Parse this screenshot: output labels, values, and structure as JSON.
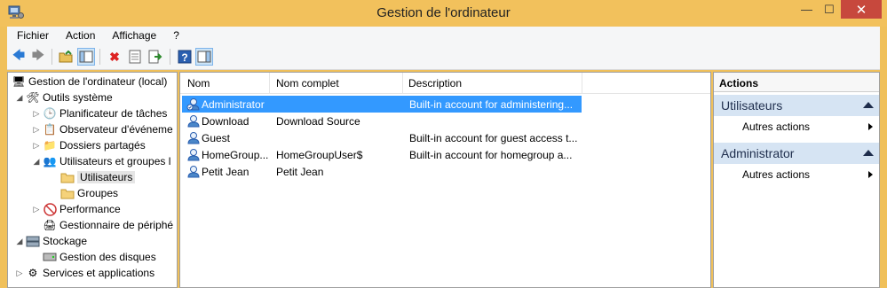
{
  "window": {
    "title": "Gestion de l'ordinateur",
    "min": "—",
    "max": "☐",
    "close": "✕"
  },
  "menu": [
    "Fichier",
    "Action",
    "Affichage",
    "?"
  ],
  "tree": [
    {
      "label": "Gestion de l'ordinateur (local)",
      "icon": "computer-icon",
      "expander": ""
    },
    {
      "label": "Outils système",
      "icon": "tools-icon",
      "expander": "◢"
    },
    {
      "label": "Planificateur de tâches",
      "icon": "clock-icon",
      "expander": "▷"
    },
    {
      "label": "Observateur d'événeme",
      "icon": "event-viewer-icon",
      "expander": "▷"
    },
    {
      "label": "Dossiers partagés",
      "icon": "shared-folder-icon",
      "expander": "▷"
    },
    {
      "label": "Utilisateurs et groupes l",
      "icon": "users-groups-icon",
      "expander": "◢"
    },
    {
      "label": "Utilisateurs",
      "icon": "folder-icon",
      "expander": ""
    },
    {
      "label": "Groupes",
      "icon": "folder-icon",
      "expander": ""
    },
    {
      "label": "Performance",
      "icon": "performance-icon",
      "expander": "▷"
    },
    {
      "label": "Gestionnaire de périphé",
      "icon": "device-manager-icon",
      "expander": ""
    },
    {
      "label": "Stockage",
      "icon": "storage-icon",
      "expander": "◢"
    },
    {
      "label": "Gestion des disques",
      "icon": "disk-icon",
      "expander": ""
    },
    {
      "label": "Services et applications",
      "icon": "services-icon",
      "expander": "▷"
    }
  ],
  "list": {
    "columns": [
      "Nom",
      "Nom complet",
      "Description"
    ],
    "rows": [
      {
        "name": "Administrator",
        "full": "",
        "desc": "Built-in account for administering..."
      },
      {
        "name": "Download",
        "full": "Download Source",
        "desc": ""
      },
      {
        "name": "Guest",
        "full": "",
        "desc": "Built-in account for guest access t..."
      },
      {
        "name": "HomeGroup...",
        "full": "HomeGroupUser$",
        "desc": "Built-in account for homegroup a..."
      },
      {
        "name": "Petit Jean",
        "full": "Petit Jean",
        "desc": ""
      }
    ]
  },
  "actions": {
    "header": "Actions",
    "sections": [
      {
        "title": "Utilisateurs",
        "item": "Autres actions"
      },
      {
        "title": "Administrator",
        "item": "Autres actions"
      }
    ]
  },
  "colors": {
    "titlebar": "#f2c15c",
    "selection": "#3399ff",
    "close": "#c7483d",
    "action_section": "#d6e4f3"
  }
}
